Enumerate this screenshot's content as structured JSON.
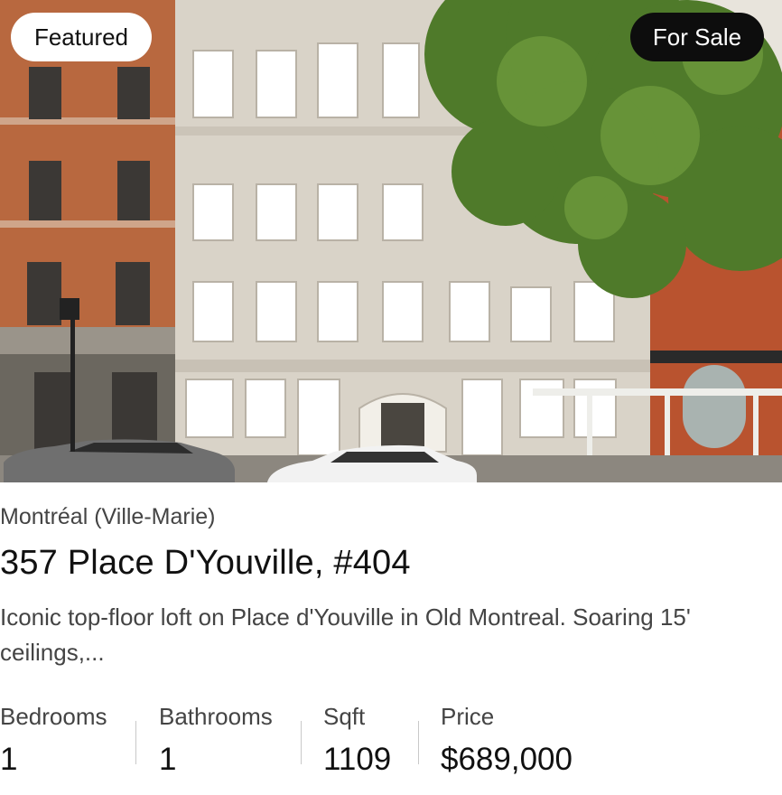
{
  "badges": {
    "featured": "Featured",
    "status": "For Sale"
  },
  "listing": {
    "location": "Montréal (Ville-Marie)",
    "address": "357 Place D'Youville, #404",
    "description": "Iconic top-floor loft on Place d'Youville in Old Montreal. Soaring 15' ceilings,..."
  },
  "stats": {
    "bedrooms": {
      "label": "Bedrooms",
      "value": "1"
    },
    "bathrooms": {
      "label": "Bathrooms",
      "value": "1"
    },
    "sqft": {
      "label": "Sqft",
      "value": "1109"
    },
    "price": {
      "label": "Price",
      "value": "$689,000"
    }
  }
}
